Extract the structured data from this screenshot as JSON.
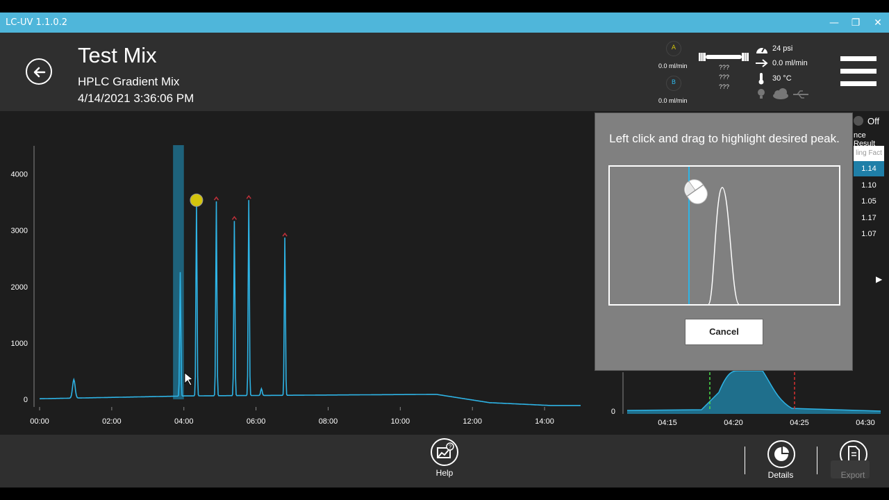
{
  "window": {
    "title": "LC-UV 1.1.0.2",
    "minimize": "—",
    "restore": "❐",
    "close": "✕"
  },
  "header": {
    "title": "Test Mix",
    "method": "HPLC Gradient Mix",
    "datetime": "4/14/2021 3:36:06 PM"
  },
  "status": {
    "pump_a_label": "A",
    "pump_a_flow": "0.0 ml/min",
    "pump_b_label": "B",
    "pump_b_flow": "0.0 ml/min",
    "column_unknown_1": "???",
    "column_unknown_2": "???",
    "column_unknown_3": "???",
    "pressure": "24 psi",
    "flow": "0.0 ml/min",
    "temperature": "30 °C"
  },
  "chart_data": {
    "type": "line",
    "x_ticks": [
      "00:00",
      "02:00",
      "04:00",
      "06:00",
      "08:00",
      "10:00",
      "12:00",
      "14:00"
    ],
    "y_ticks": [
      "0",
      "1000",
      "2000",
      "3000",
      "4000"
    ],
    "xlim_minutes": [
      0,
      15
    ],
    "ylim": [
      0,
      4500
    ],
    "highlight_minutes": [
      3.7,
      4.0
    ],
    "peaks": [
      {
        "x": 0.95,
        "y": 330
      },
      {
        "x": 3.9,
        "y": 2200
      },
      {
        "x": 4.35,
        "y": 3400
      },
      {
        "x": 4.9,
        "y": 3450
      },
      {
        "x": 5.4,
        "y": 3100
      },
      {
        "x": 5.8,
        "y": 3470
      },
      {
        "x": 6.8,
        "y": 2800
      }
    ],
    "selected_peak_index": 2
  },
  "zoom_chart": {
    "x_ticks": [
      "04:15",
      "04:20",
      "04:25",
      "04:30"
    ],
    "y_tick": "0"
  },
  "dialog": {
    "message": "Left click and drag to highlight desired peak.",
    "cancel_label": "Cancel"
  },
  "side_panel": {
    "toggle_label": "Off",
    "header": "nce Result",
    "column_header": "ling Fact",
    "values": [
      "1.14",
      "1.10",
      "1.05",
      "1.17",
      "1.07"
    ],
    "selected_index": 0,
    "expand_icon": "▶"
  },
  "toolbar": {
    "help_label": "Help",
    "details_label": "Details",
    "export_label": "Export"
  },
  "colors": {
    "accent": "#4fb6da",
    "trace": "#2eb4e6",
    "highlight": "#1f6f8c",
    "peak_marker": "#d4c40c"
  }
}
